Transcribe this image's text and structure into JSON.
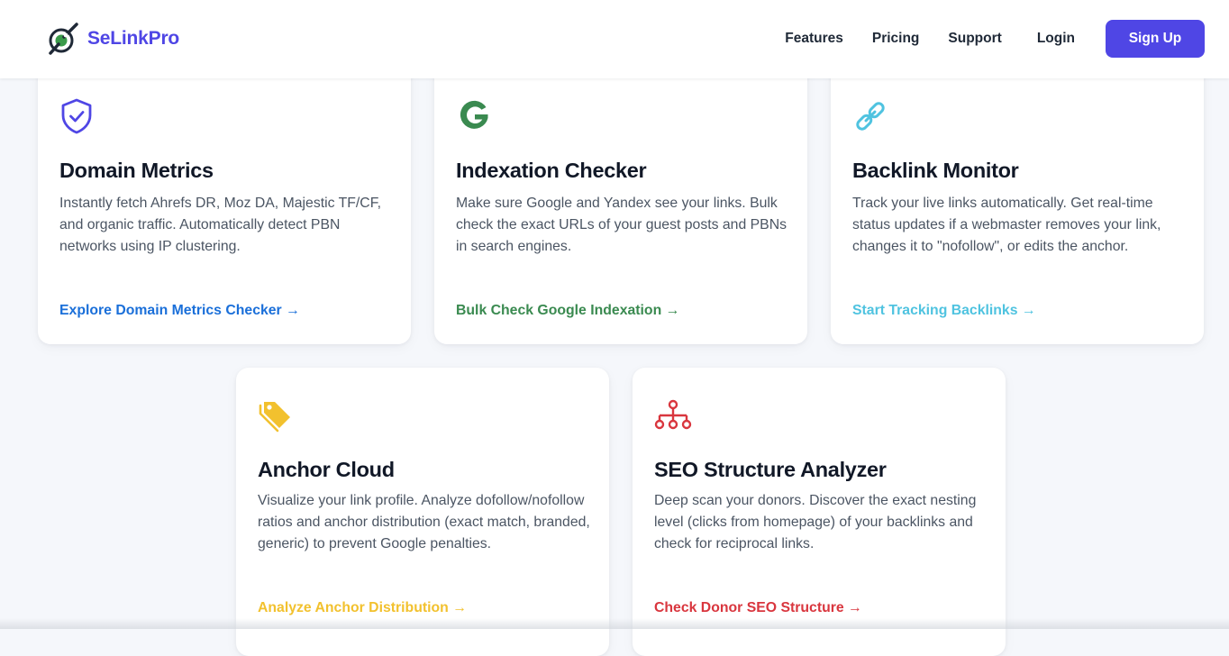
{
  "header": {
    "brand": "SeLinkPro",
    "nav": {
      "features": "Features",
      "pricing": "Pricing",
      "support": "Support",
      "login": "Login",
      "signup": "Sign Up"
    }
  },
  "colors": {
    "brand": "#4f46e5",
    "domain_metrics": "#1a6fd9",
    "indexation": "#3a8a50",
    "backlink": "#4fc3e0",
    "anchor": "#f2c12e",
    "seo": "#d9363e"
  },
  "cards": [
    {
      "icon": "shield-check-icon",
      "title": "Domain Metrics",
      "description": "Instantly fetch Ahrefs DR, Moz DA, Majestic TF/CF, and organic traffic. Automatically detect PBN networks using IP clustering.",
      "link": "Explore Domain Metrics Checker →"
    },
    {
      "icon": "google-icon",
      "title": "Indexation Checker",
      "description": "Make sure Google and Yandex see your links. Bulk check the exact URLs of your guest posts and PBNs in search engines.",
      "link": "Bulk Check Google Indexation →"
    },
    {
      "icon": "link-icon",
      "title": "Backlink Monitor",
      "description": "Track your live links automatically. Get real-time status updates if a webmaster removes your link, changes it to \"nofollow\", or edits the anchor.",
      "link": "Start Tracking Backlinks →"
    },
    {
      "icon": "tags-icon",
      "title": "Anchor Cloud",
      "description": "Visualize your link profile. Analyze dofollow/nofollow ratios and anchor distribution (exact match, branded, generic) to prevent Google penalties.",
      "link": "Analyze Anchor Distribution →"
    },
    {
      "icon": "sitemap-icon",
      "title": "SEO Structure Analyzer",
      "description": "Deep scan your donors. Discover the exact nesting level (clicks from homepage) of your backlinks and check for reciprocal links.",
      "link": "Check Donor SEO Structure →"
    }
  ]
}
